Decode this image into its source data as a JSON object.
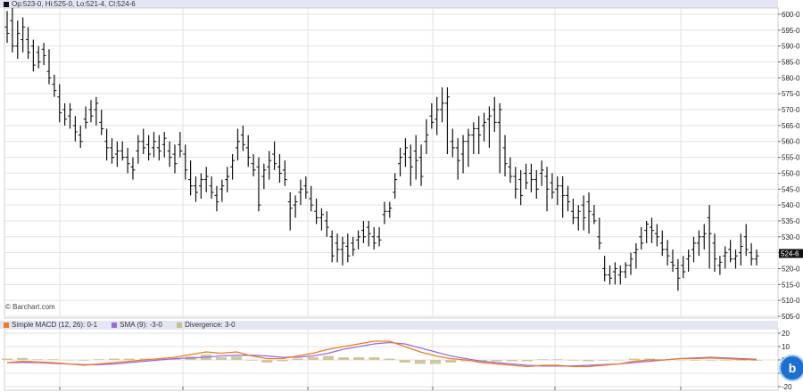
{
  "price_header": {
    "text": "Op:523-0, Hi:525-0, Lo:521-4, Cl:524-6"
  },
  "watermark": "© Barchart.com",
  "last_price_label": "524-6",
  "macd_header": {
    "items": [
      {
        "label": "Simple MACD (12, 26): 0-1",
        "color": "#f07a1e"
      },
      {
        "label": "SMA (9): -3-0",
        "color": "#9a6ae0"
      },
      {
        "label": "Divergence: 3-0",
        "color": "#c8c08a"
      }
    ]
  },
  "colors": {
    "bars": "#111111",
    "macd": "#f07a1e",
    "signal": "#9a6ae0",
    "histogram": "#cfc89a",
    "grid": "#e2e2e2",
    "header_bg": "#e4e6f6",
    "badge": "#1e6fd0"
  },
  "badge_icon": "b-icon",
  "chart_data": [
    {
      "type": "ohlc",
      "y_ticks": [
        "600-0",
        "595-0",
        "590-0",
        "585-0",
        "580-0",
        "575-0",
        "570-0",
        "565-0",
        "560-0",
        "555-0",
        "550-0",
        "545-0",
        "540-0",
        "535-0",
        "530-0",
        "525-0",
        "520-0",
        "515-0",
        "510-0",
        "505-0"
      ],
      "ylim": [
        505,
        600
      ],
      "grid": true,
      "bars": [
        [
          596,
          601,
          591,
          594
        ],
        [
          598,
          602,
          588,
          590
        ],
        [
          590,
          598,
          586,
          594
        ],
        [
          592,
          599,
          588,
          596
        ],
        [
          592,
          596,
          586,
          588
        ],
        [
          590,
          592,
          582,
          584
        ],
        [
          588,
          590,
          583,
          585
        ],
        [
          589,
          591,
          584,
          587
        ],
        [
          582,
          589,
          578,
          580
        ],
        [
          578,
          581,
          574,
          576
        ],
        [
          574,
          578,
          566,
          569
        ],
        [
          570,
          572,
          565,
          567
        ],
        [
          568,
          572,
          564,
          570
        ],
        [
          565,
          568,
          560,
          563
        ],
        [
          562,
          565,
          558,
          560
        ],
        [
          567,
          571,
          564,
          566
        ],
        [
          570,
          573,
          566,
          568
        ],
        [
          570,
          574,
          565,
          572
        ],
        [
          566,
          570,
          562,
          564
        ],
        [
          560,
          564,
          554,
          558
        ],
        [
          558,
          561,
          553,
          555
        ],
        [
          556,
          560,
          552,
          557
        ],
        [
          557,
          560,
          554,
          555
        ],
        [
          555,
          558,
          550,
          553
        ],
        [
          552,
          555,
          548,
          551
        ],
        [
          557,
          562,
          553,
          560
        ],
        [
          560,
          564,
          556,
          558
        ],
        [
          559,
          562,
          554,
          556
        ],
        [
          558,
          563,
          555,
          560
        ],
        [
          558,
          562,
          554,
          557
        ],
        [
          559,
          563,
          555,
          561
        ],
        [
          557,
          560,
          552,
          555
        ],
        [
          556,
          559,
          550,
          553
        ],
        [
          559,
          563,
          555,
          557
        ],
        [
          556,
          559,
          548,
          551
        ],
        [
          548,
          554,
          543,
          546
        ],
        [
          546,
          549,
          541,
          544
        ],
        [
          546,
          550,
          542,
          548
        ],
        [
          548,
          552,
          544,
          549
        ],
        [
          546,
          549,
          542,
          544
        ],
        [
          543,
          546,
          538,
          541
        ],
        [
          545,
          548,
          541,
          546
        ],
        [
          548,
          552,
          544,
          549
        ],
        [
          552,
          556,
          548,
          554
        ],
        [
          558,
          564,
          554,
          560
        ],
        [
          562,
          565,
          557,
          559
        ],
        [
          558,
          562,
          552,
          555
        ],
        [
          553,
          556,
          549,
          551
        ],
        [
          552,
          555,
          538,
          540
        ],
        [
          549,
          553,
          545,
          551
        ],
        [
          552,
          557,
          548,
          554
        ],
        [
          556,
          560,
          551,
          553
        ],
        [
          552,
          556,
          547,
          550
        ],
        [
          551,
          554,
          546,
          548
        ],
        [
          541,
          544,
          532,
          539
        ],
        [
          540,
          543,
          536,
          541
        ],
        [
          544,
          548,
          540,
          545
        ],
        [
          546,
          549,
          542,
          544
        ],
        [
          542,
          546,
          538,
          540
        ],
        [
          538,
          542,
          534,
          536
        ],
        [
          536,
          539,
          532,
          537
        ],
        [
          535,
          538,
          530,
          533
        ],
        [
          530,
          532,
          522,
          524
        ],
        [
          528,
          531,
          522,
          526
        ],
        [
          526,
          530,
          521,
          528
        ],
        [
          527,
          531,
          522,
          524
        ],
        [
          528,
          530,
          524,
          526
        ],
        [
          529,
          532,
          526,
          530
        ],
        [
          532,
          535,
          528,
          530
        ],
        [
          533,
          535,
          527,
          531
        ],
        [
          530,
          533,
          526,
          528
        ],
        [
          530,
          533,
          527,
          529
        ],
        [
          537,
          541,
          534,
          538
        ],
        [
          538,
          541,
          536,
          539
        ],
        [
          544,
          550,
          542,
          548
        ],
        [
          553,
          558,
          549,
          555
        ],
        [
          556,
          561,
          552,
          558
        ],
        [
          555,
          559,
          546,
          552
        ],
        [
          557,
          562,
          548,
          554
        ],
        [
          555,
          559,
          546,
          549
        ],
        [
          560,
          567,
          556,
          562
        ],
        [
          568,
          572,
          564,
          566
        ],
        [
          567,
          574,
          562,
          570
        ],
        [
          570,
          577,
          566,
          572
        ],
        [
          572,
          577,
          556,
          574
        ],
        [
          560,
          564,
          555,
          558
        ],
        [
          558,
          561,
          548,
          554
        ],
        [
          556,
          562,
          550,
          560
        ],
        [
          560,
          564,
          552,
          562
        ],
        [
          562,
          566,
          556,
          564
        ],
        [
          564,
          568,
          556,
          562
        ],
        [
          565,
          569,
          560,
          566
        ],
        [
          567,
          571,
          558,
          568
        ],
        [
          570,
          574,
          563,
          566
        ],
        [
          566,
          572,
          550,
          570
        ],
        [
          558,
          562,
          549,
          553
        ],
        [
          552,
          555,
          547,
          549
        ],
        [
          549,
          552,
          542,
          545
        ],
        [
          548,
          551,
          540,
          543
        ],
        [
          550,
          553,
          545,
          547
        ],
        [
          550,
          553,
          544,
          548
        ],
        [
          548,
          551,
          542,
          545
        ],
        [
          550,
          554,
          546,
          551
        ],
        [
          549,
          552,
          538,
          545
        ],
        [
          547,
          550,
          542,
          544
        ],
        [
          545,
          549,
          540,
          546
        ],
        [
          546,
          549,
          536,
          543
        ],
        [
          543,
          546,
          538,
          541
        ],
        [
          538,
          542,
          534,
          536
        ],
        [
          536,
          540,
          532,
          538
        ],
        [
          540,
          543,
          532,
          536
        ],
        [
          541,
          544,
          531,
          538
        ],
        [
          537,
          540,
          534,
          535
        ],
        [
          530,
          536,
          526,
          528
        ],
        [
          520,
          524,
          516,
          518
        ],
        [
          518,
          521,
          515,
          517
        ],
        [
          519,
          522,
          515,
          520
        ],
        [
          518,
          521,
          515,
          519
        ],
        [
          519,
          522,
          517,
          521
        ],
        [
          521,
          525,
          518,
          523
        ],
        [
          525,
          528,
          520,
          526
        ],
        [
          530,
          533,
          526,
          528
        ],
        [
          532,
          535,
          528,
          534
        ],
        [
          533,
          536,
          528,
          532
        ],
        [
          531,
          534,
          527,
          530
        ],
        [
          528,
          532,
          524,
          526
        ],
        [
          526,
          529,
          521,
          524
        ],
        [
          522,
          526,
          519,
          521
        ],
        [
          520,
          523,
          513,
          517
        ],
        [
          521,
          524,
          517,
          519
        ],
        [
          523,
          526,
          519,
          524
        ],
        [
          526,
          530,
          522,
          528
        ],
        [
          528,
          532,
          524,
          530
        ],
        [
          530,
          534,
          526,
          531
        ],
        [
          536,
          540,
          520,
          531
        ],
        [
          528,
          531,
          519,
          523
        ],
        [
          521,
          524,
          518,
          522
        ],
        [
          524,
          527,
          520,
          525
        ],
        [
          526,
          529,
          522,
          523
        ],
        [
          523,
          526,
          520,
          524
        ],
        [
          525,
          531,
          521,
          527
        ],
        [
          530,
          534,
          524,
          526
        ],
        [
          525,
          528,
          521,
          523
        ],
        [
          523,
          526,
          521,
          524
        ]
      ]
    },
    {
      "type": "macd",
      "y_ticks": [
        "20",
        "10",
        "0",
        "-10",
        "-20"
      ],
      "ylim": [
        -20,
        20
      ],
      "series": [
        {
          "values": [
            -2,
            -1,
            -1.5,
            -2,
            -3,
            -4,
            -3,
            -2,
            -1,
            0,
            1,
            2,
            4,
            6,
            5,
            6,
            3,
            1,
            1,
            3,
            5,
            8,
            10,
            12,
            14,
            14,
            10,
            6,
            3,
            1,
            0,
            -2,
            -3,
            -4,
            -5,
            -4,
            -4,
            -5,
            -5,
            -4,
            -3,
            -1,
            0,
            0,
            1,
            1,
            1.5,
            1,
            0.5,
            0
          ]
        },
        {
          "values": [
            -2,
            -2,
            -2,
            -2.5,
            -3,
            -3.5,
            -3.5,
            -3,
            -2,
            -1,
            0,
            1,
            1.5,
            2,
            3,
            3.5,
            3.5,
            3,
            2,
            2,
            3,
            5,
            8,
            10,
            12,
            13,
            12,
            9,
            6,
            3,
            1,
            -1,
            -2,
            -3,
            -4,
            -4.5,
            -4.5,
            -4.5,
            -4,
            -3.5,
            -3,
            -2,
            -1,
            0,
            1,
            1.5,
            2,
            1.5,
            1,
            0.5
          ]
        },
        {
          "values": [
            1,
            1.5,
            0.5,
            0.5,
            0,
            -0.5,
            0.5,
            1,
            1,
            1,
            1,
            1,
            2.5,
            4,
            2,
            2.5,
            -0.5,
            -2,
            -1,
            1,
            2,
            3,
            2,
            2,
            2,
            1,
            -2,
            -3,
            -3,
            -2,
            -1,
            -1,
            -1,
            -1,
            -1,
            0.5,
            0.5,
            -0.5,
            -1,
            -0.5,
            0,
            1,
            1,
            0,
            0,
            -0.5,
            -0.5,
            -0.5,
            -0.5,
            -0.5
          ]
        }
      ],
      "grid": true
    }
  ]
}
